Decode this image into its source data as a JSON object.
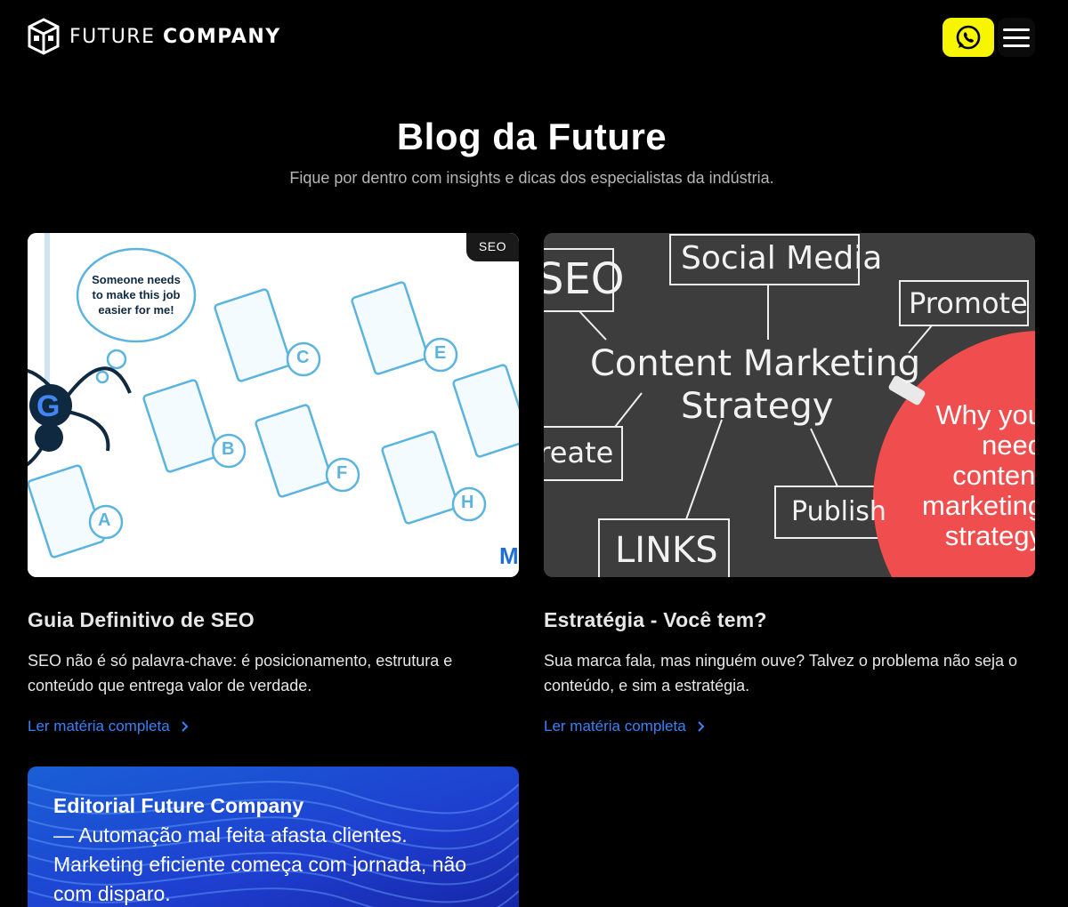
{
  "header": {
    "logo_light": "FUTURE",
    "logo_bold": "COMPANY",
    "whatsapp_icon": "whatsapp-icon",
    "menu_icon": "hamburger-menu-icon",
    "accent_color": "#f8f500"
  },
  "hero": {
    "title": "Blog da Future",
    "subtitle": "Fique por dentro com insights e dicas dos especialistas da indústria."
  },
  "posts": [
    {
      "badge": "SEO",
      "image": {
        "bubble": "Someone needs to make this job easier for me!",
        "letters": [
          "A",
          "B",
          "C",
          "E",
          "F",
          "H"
        ]
      },
      "title": "Guia Definitivo de SEO",
      "excerpt": "SEO não é só palavra-chave: é posicionamento, estrutura e conteúdo que entrega valor de verdade.",
      "link": "Ler matéria completa"
    },
    {
      "image": {
        "words": [
          "SEO",
          "Social Media",
          "Promote",
          "Content Marketing",
          "Strategy",
          "Create",
          "Publish",
          "LINKS"
        ],
        "circle_text": "Why you need content marketing strategy"
      },
      "title": "Estratégia - Você tem?",
      "excerpt": "Sua marca fala, mas ninguém ouve? Talvez o problema não seja o conteúdo, e sim a estratégia.",
      "link": "Ler matéria completa"
    },
    {
      "image_heading": "Editorial Future Company",
      "image_text": "— Automação mal feita afasta clientes. Marketing eficiente começa com jornada, não com disparo."
    }
  ],
  "colors": {
    "background": "#000000",
    "link": "#3b82f6",
    "chalkboard": "#3a3a3a",
    "circle": "#f04e4e",
    "wave_blue": "#1e3fd0"
  }
}
